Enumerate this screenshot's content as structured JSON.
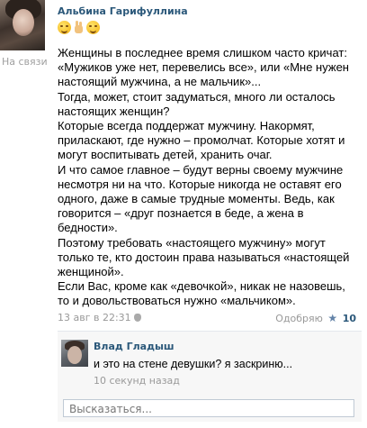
{
  "post": {
    "author": "Альбина Гарифуллина",
    "status": "На связи",
    "emojis": [
      "relieved-face",
      "victory-hand",
      "smiling-face"
    ],
    "paragraphs": [
      "Женщины в последнее время слишком часто кричат: «Мужиков уже нет, перевелись все», или «Мне нужен настоящий мужчина, а не мальчик»...",
      "Тогда, может, стоит задуматься, много ли осталось настоящих женщин?",
      "Которые всегда поддержат мужчину. Накормят, приласкают, где нужно – промолчат. Которые хотят и могут воспитывать детей, хранить очаг.",
      "И что самое главное – будут верны своему мужчине несмотря ни на что. Которые никогда не оставят его одного, даже в самые трудные моменты. Ведь, как говорится – «друг познается в беде, а жена в бедности».",
      "Поэтому требовать «настоящего мужчину» могут только те, кто достоин права называться «настоящей женщиной».",
      "Если Вас, кроме как «девочкой», никак не назовешь, то и довольствоваться нужно «мальчиком»."
    ],
    "date": "13 авг в 22:31",
    "like_label": "Одобряю",
    "like_count": "10"
  },
  "comment": {
    "author": "Влад Гладыш",
    "text": "и это на стене девушки? я заскриню...",
    "time": "10 секунд назад"
  },
  "reply": {
    "placeholder": "Высказаться..."
  },
  "colors": {
    "link": "#2b587a",
    "muted": "#999999",
    "comment_bg": "#f7f7f7"
  }
}
